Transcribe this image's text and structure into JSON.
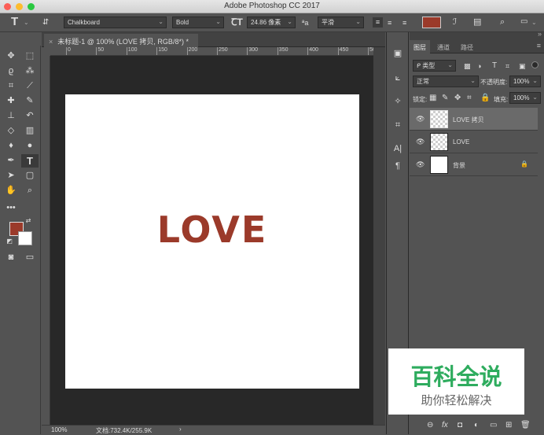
{
  "window": {
    "title": "Adobe Photoshop CC 2017"
  },
  "options": {
    "font_family": "Chalkboard",
    "font_style": "Bold",
    "font_size": "24.86 像素",
    "aa_icon": "ªa",
    "antialias": "平滑",
    "text_color": "#9b3a2a"
  },
  "document": {
    "tab_title": "未标题-1 @ 100% (LOVE 拷贝, RGB/8*) *",
    "close": "×",
    "canvas_text": "LOVE",
    "text_color": "#9b3a2a",
    "zoom": "100%",
    "doc_info": "文档:732.4K/255.9K",
    "arrow": "›"
  },
  "ruler": {
    "labels": [
      "0",
      "50",
      "100",
      "150",
      "200",
      "250",
      "300",
      "350",
      "400",
      "450",
      "500"
    ]
  },
  "colors": {
    "foreground": "#9b3a2a",
    "background": "#ffffff"
  },
  "layers_panel": {
    "tabs": [
      "图层",
      "通道",
      "路径"
    ],
    "filter": "ᑭ 类型",
    "blend": "正常",
    "opacity_label": "不透明度:",
    "opacity": "100%",
    "lock_label": "锁定:",
    "fill_label": "填充:",
    "fill": "100%",
    "layers": [
      {
        "name": "LOVE 拷贝",
        "selected": true
      },
      {
        "name": "LOVE",
        "selected": false
      },
      {
        "name": "背景",
        "selected": false
      }
    ],
    "footer": [
      "⊖",
      "fx",
      "◘",
      "◐",
      "▭",
      "⊞",
      "🗑"
    ]
  },
  "watermark": {
    "title": "百科全说",
    "subtitle": "助你轻松解决"
  }
}
